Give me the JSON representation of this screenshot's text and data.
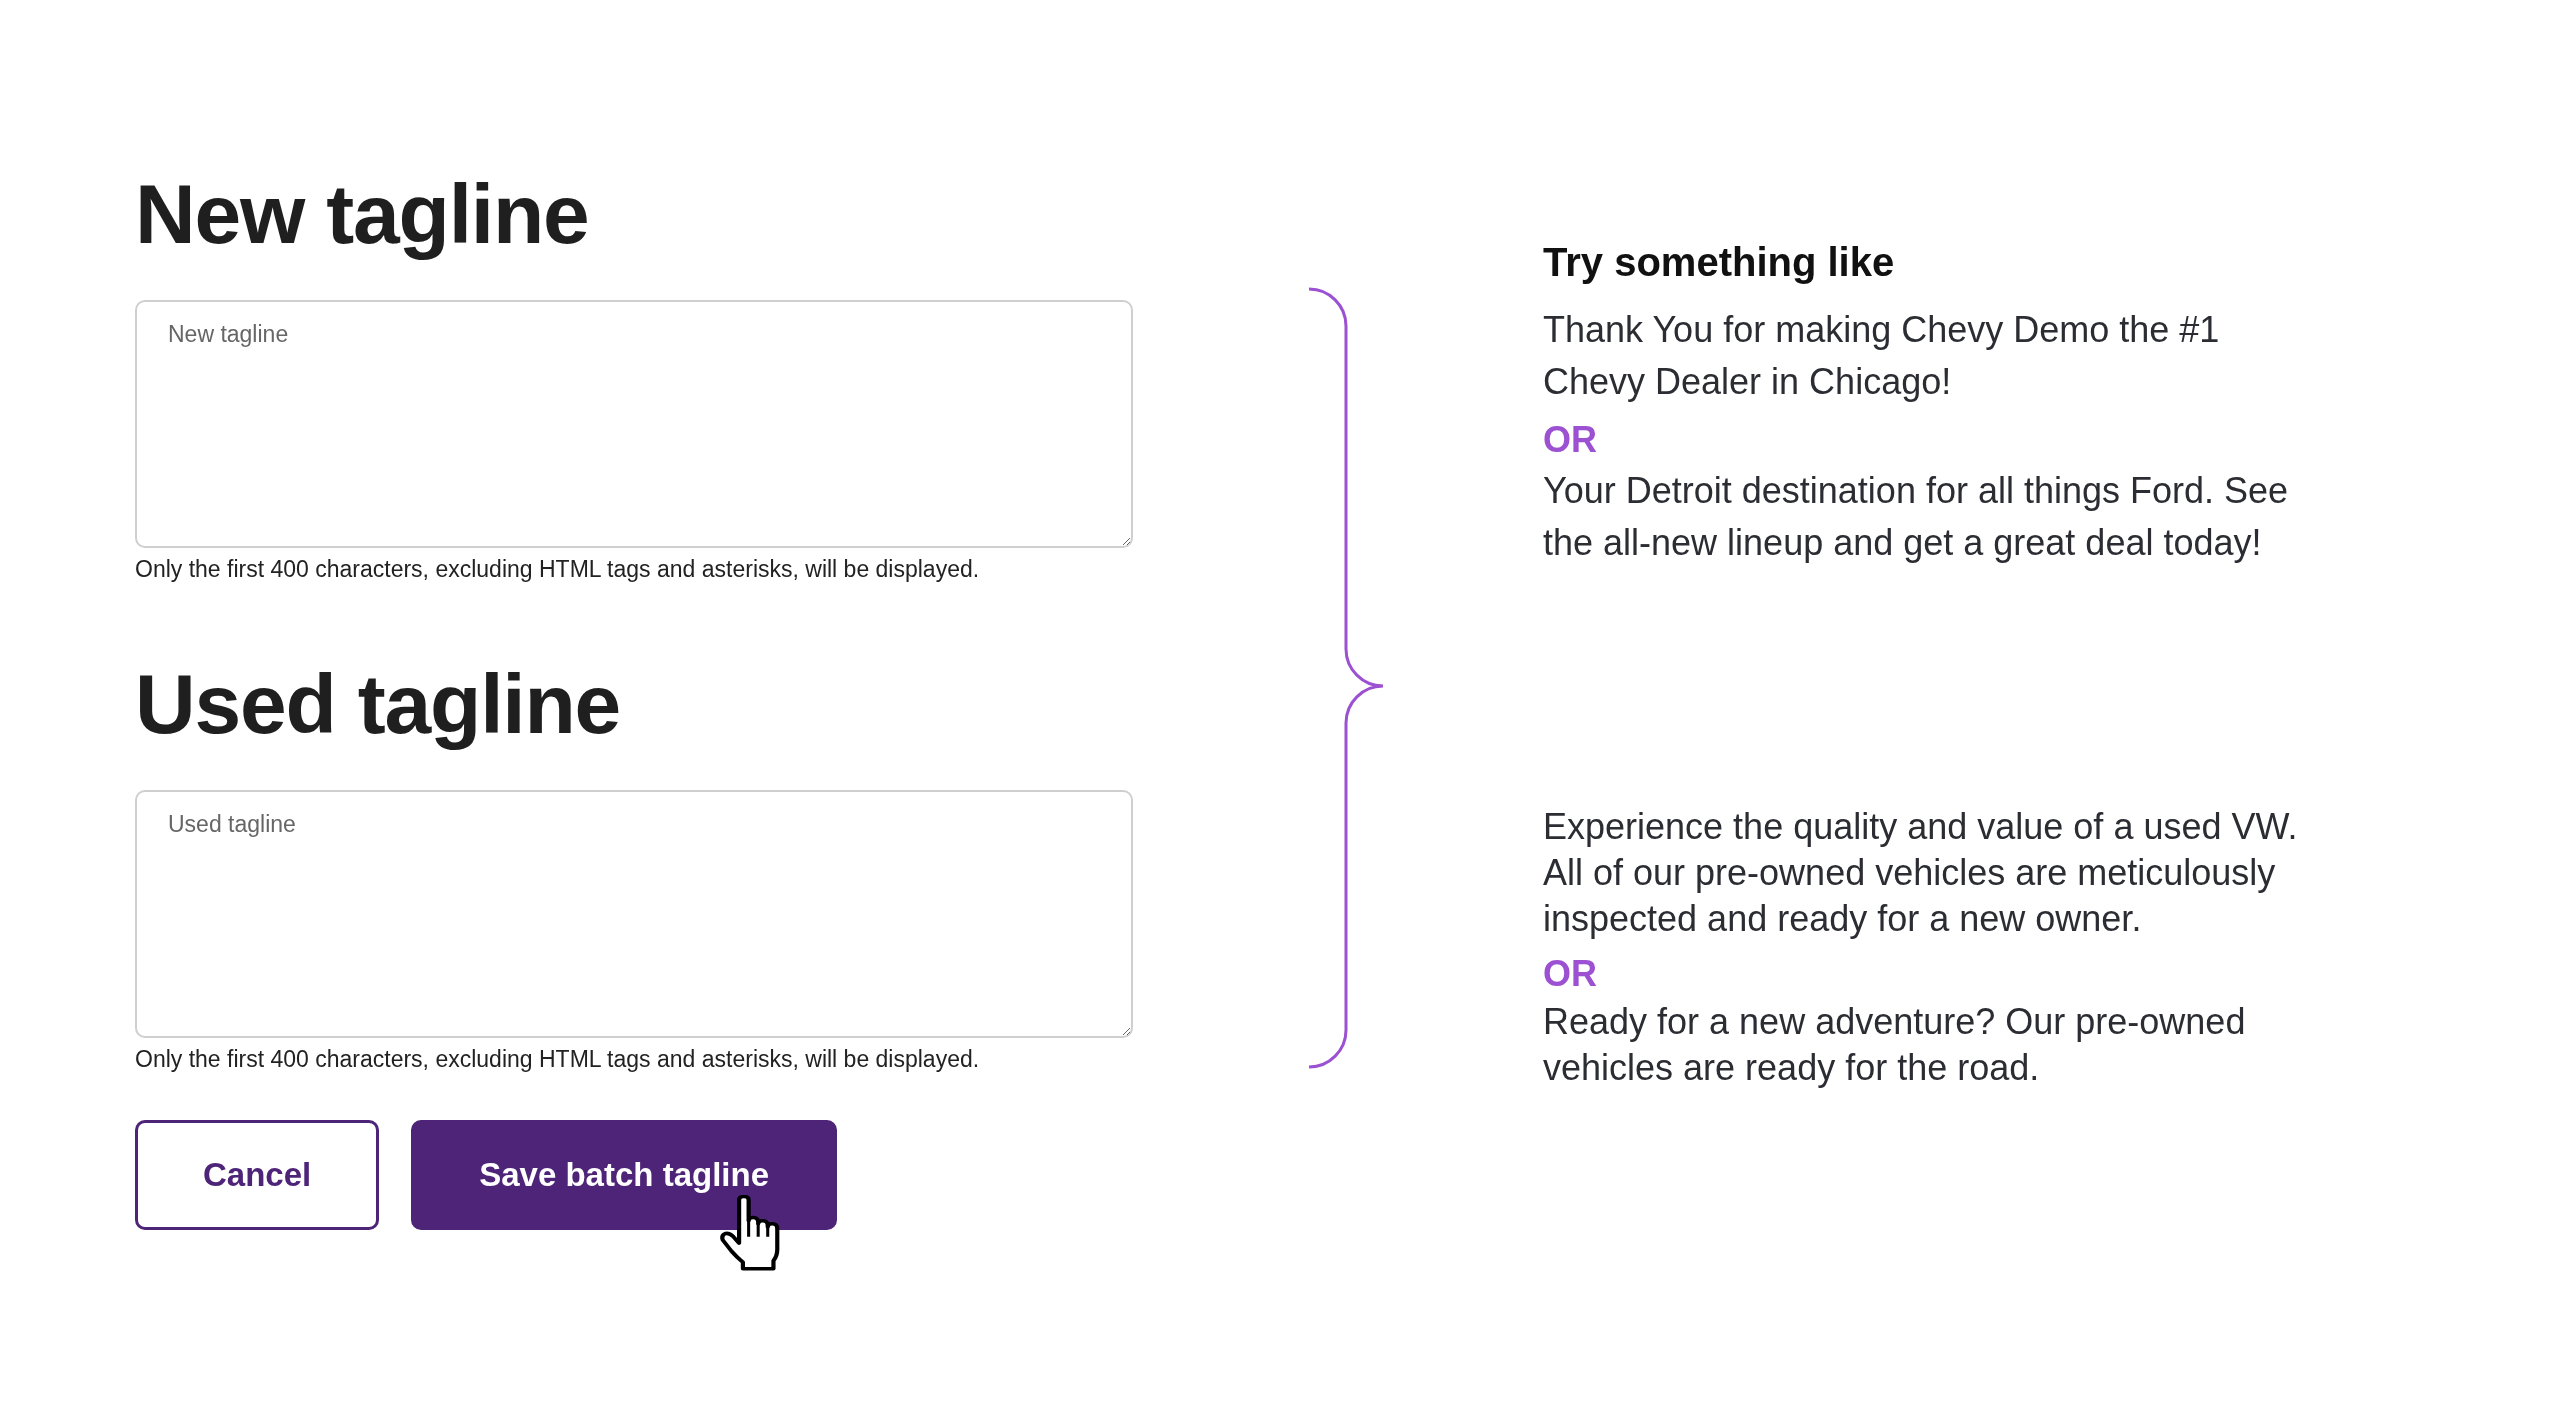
{
  "sections": [
    {
      "heading": "New tagline",
      "field": {
        "placeholder": "New tagline"
      },
      "helper_text": "Only the first 400 characters, excluding HTML tags and asterisks, will be displayed."
    },
    {
      "heading": "Used tagline",
      "field": {
        "placeholder": "Used tagline"
      },
      "helper_text": "Only the first 400 characters, excluding HTML tags and asterisks, will be displayed."
    }
  ],
  "buttons": [
    {
      "label": "Cancel",
      "kind": "secondary"
    },
    {
      "label": "Save batch tagline",
      "kind": "primary"
    }
  ],
  "suggestions": {
    "title": "Try something like",
    "groups": [
      {
        "items": [
          {
            "kind": "example",
            "text": "Thank You for making Chevy Demo the #1\nChevy Dealer in Chicago!"
          },
          {
            "kind": "separator",
            "text": "OR"
          },
          {
            "kind": "example",
            "text": "Your Detroit destination for all things Ford. See\nthe all-new lineup and get a great deal today!"
          }
        ]
      },
      {
        "items": [
          {
            "kind": "example",
            "text": "Experience the quality and value of a used VW.\nAll of our pre-owned vehicles are meticulously\ninspected and ready for a new owner."
          },
          {
            "kind": "separator",
            "text": "OR"
          },
          {
            "kind": "example",
            "text": "Ready for a new adventure? Our pre-owned\nvehicles are ready for the road."
          }
        ]
      }
    ]
  }
}
